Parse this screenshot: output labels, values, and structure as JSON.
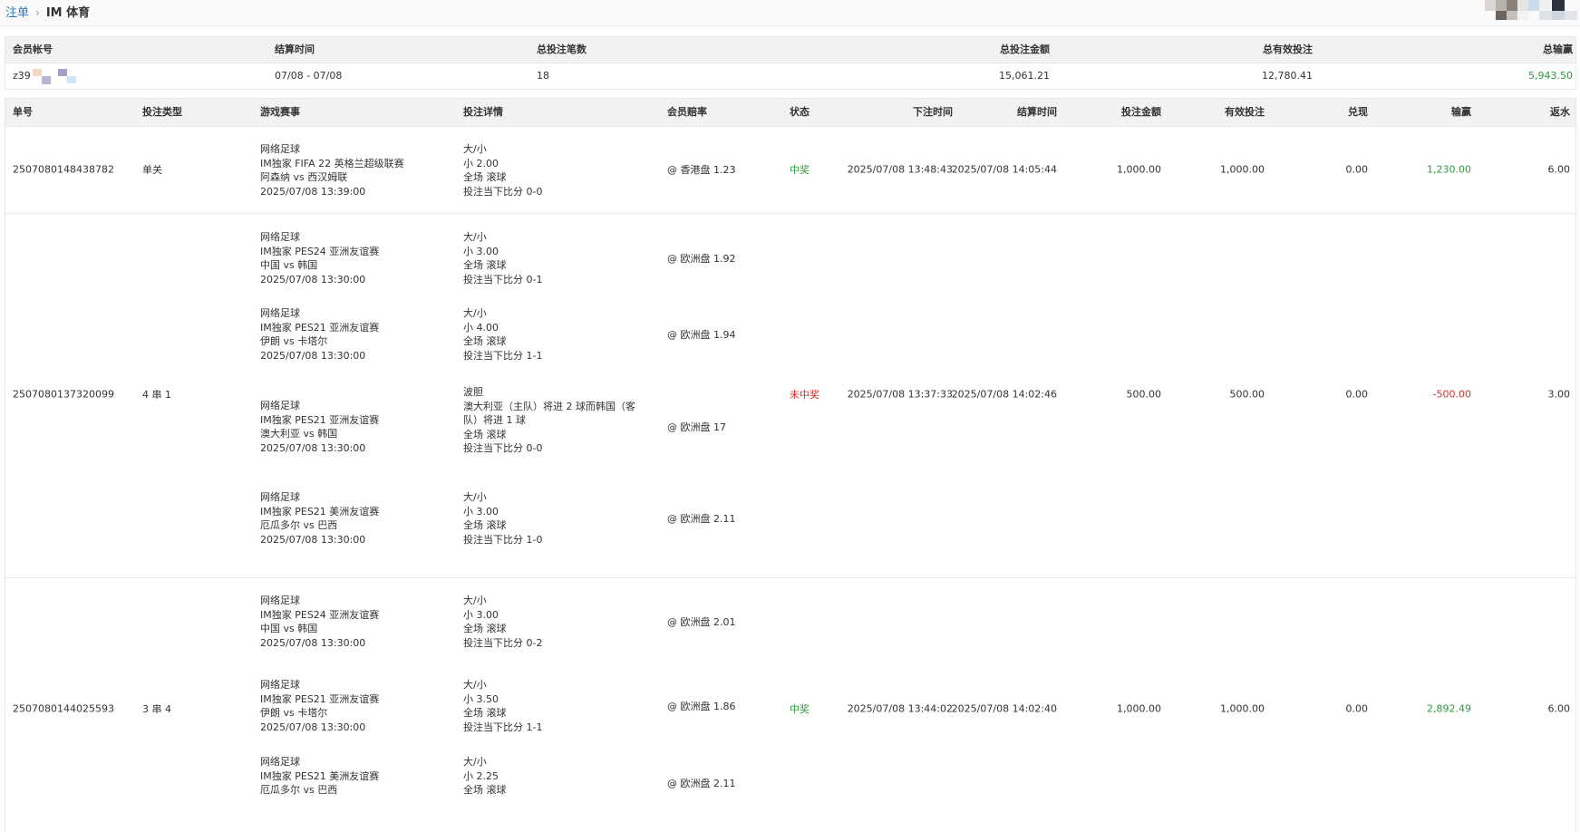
{
  "breadcrumb": {
    "root": "注单",
    "separator": "›",
    "current": "IM 体育"
  },
  "summary": {
    "headers": {
      "account": "会员帐号",
      "settle_time": "结算时间",
      "bet_count": "总投注笔数",
      "total_bet": "总投注金额",
      "total_valid": "总有效投注",
      "total_winloss": "总输赢"
    },
    "row": {
      "account": "z39",
      "settle_time": "07/08 - 07/08",
      "bet_count": "18",
      "total_bet": "15,061.21",
      "total_valid": "12,780.41",
      "total_winloss": "5,943.50"
    }
  },
  "columns": {
    "order_no": "单号",
    "bet_type": "投注类型",
    "match": "游戏赛事",
    "detail": "投注详情",
    "odds": "会员赔率",
    "status": "状态",
    "bet_time": "下注时间",
    "settle_time": "结算时间",
    "amount": "投注金额",
    "valid": "有效投注",
    "cashout": "兑现",
    "winloss": "输赢",
    "rebate": "返水"
  },
  "bets": [
    {
      "order_no": "2507080148438782",
      "bet_type": "单关",
      "status": "中奖",
      "bet_time": "2025/07/08 13:48:43",
      "settle_time": "2025/07/08 14:05:44",
      "amount": "1,000.00",
      "valid": "1,000.00",
      "cashout": "0.00",
      "winloss": "1,230.00",
      "rebate": "6.00",
      "legs": [
        {
          "sport": "网络足球",
          "league": "IM独家 FIFA 22 英格兰超级联赛",
          "teams": "阿森纳 vs 西汉姆联",
          "time": "2025/07/08 13:39:00",
          "market": "大/小",
          "selection": "小 2.00",
          "scope": "全场 滚球",
          "score": "投注当下比分 0-0",
          "odds": "@ 香港盘 1.23"
        }
      ]
    },
    {
      "order_no": "2507080137320099",
      "bet_type": "4 串 1",
      "status": "未中奖",
      "bet_time": "2025/07/08 13:37:33",
      "settle_time": "2025/07/08 14:02:46",
      "amount": "500.00",
      "valid": "500.00",
      "cashout": "0.00",
      "winloss": "-500.00",
      "rebate": "3.00",
      "legs": [
        {
          "sport": "网络足球",
          "league": "IM独家 PES24 亚洲友谊赛",
          "teams": "中国 vs 韩国",
          "time": "2025/07/08 13:30:00",
          "market": "大/小",
          "selection": "小 3.00",
          "scope": "全场 滚球",
          "score": "投注当下比分 0-1",
          "odds": "@ 欧洲盘 1.92"
        },
        {
          "sport": "网络足球",
          "league": "IM独家 PES21 亚洲友谊赛",
          "teams": "伊朗 vs 卡塔尔",
          "time": "2025/07/08 13:30:00",
          "market": "大/小",
          "selection": "小 4.00",
          "scope": "全场 滚球",
          "score": "投注当下比分 1-1",
          "odds": "@ 欧洲盘 1.94"
        },
        {
          "sport": "网络足球",
          "league": "IM独家 PES21 亚洲友谊赛",
          "teams": "澳大利亚 vs 韩国",
          "time": "2025/07/08 13:30:00",
          "market": "波胆",
          "selection": "澳大利亚（主队）将进 2 球而韩国（客队）将进 1 球",
          "scope": "全场 滚球",
          "score": "投注当下比分 0-0",
          "odds": "@ 欧洲盘 17"
        },
        {
          "sport": "网络足球",
          "league": "IM独家 PES21 美洲友谊赛",
          "teams": "厄瓜多尔 vs 巴西",
          "time": "2025/07/08 13:30:00",
          "market": "大/小",
          "selection": "小 3.00",
          "scope": "全场 滚球",
          "score": "投注当下比分 1-0",
          "odds": "@ 欧洲盘 2.11"
        }
      ]
    },
    {
      "order_no": "2507080144025593",
      "bet_type": "3 串 4",
      "status": "中奖",
      "bet_time": "2025/07/08 13:44:02",
      "settle_time": "2025/07/08 14:02:40",
      "amount": "1,000.00",
      "valid": "1,000.00",
      "cashout": "0.00",
      "winloss": "2,892.49",
      "rebate": "6.00",
      "legs": [
        {
          "sport": "网络足球",
          "league": "IM独家 PES24 亚洲友谊赛",
          "teams": "中国 vs 韩国",
          "time": "2025/07/08 13:30:00",
          "market": "大/小",
          "selection": "小 3.00",
          "scope": "全场 滚球",
          "score": "投注当下比分 0-2",
          "odds": "@ 欧洲盘 2.01"
        },
        {
          "sport": "网络足球",
          "league": "IM独家 PES21 亚洲友谊赛",
          "teams": "伊朗 vs 卡塔尔",
          "time": "2025/07/08 13:30:00",
          "market": "大/小",
          "selection": "小 3.50",
          "scope": "全场 滚球",
          "score": "投注当下比分 1-1",
          "odds": "@ 欧洲盘 1.86"
        },
        {
          "sport": "网络足球",
          "league": "IM独家 PES21 美洲友谊赛",
          "teams": "厄瓜多尔 vs 巴西",
          "time": "",
          "market": "大/小",
          "selection": "小 2.25",
          "scope": "全场 滚球",
          "score": "",
          "odds": "@ 欧洲盘 2.11"
        }
      ]
    }
  ],
  "colors": {
    "win": "#2e9a3e",
    "loss": "#d2302e",
    "link": "#2b78c5"
  }
}
